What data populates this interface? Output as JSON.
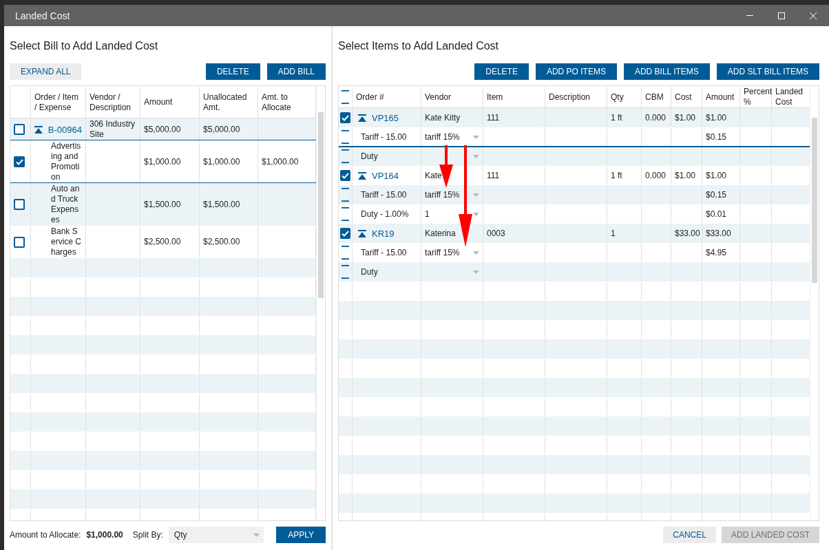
{
  "window": {
    "title": "Landed Cost"
  },
  "bill_panel": {
    "title": "Select Bill to Add Landed Cost",
    "buttons": [
      {
        "label": "EXPAND ALL",
        "kind": "secondary"
      },
      {
        "label": "DELETE",
        "kind": "primary"
      },
      {
        "label": "ADD BILL",
        "kind": "primary"
      }
    ],
    "columns": [
      "Order / Item / Expense",
      "Vendor / Description",
      "Amount",
      "Unallocated Amt.",
      "Amt. to Allocate"
    ],
    "rows": [
      {
        "kind": "bill",
        "checked": false,
        "selected": true,
        "order": "B-00964",
        "description": "306 Industry Site",
        "amount": "$5,000.00",
        "unallocated": "$5,000.00"
      },
      {
        "kind": "expense",
        "checked": true,
        "selected": true,
        "order": "Advertising and Promotion",
        "amount": "$1,000.00",
        "unallocated": "$1,000.00",
        "to_allocate": "$1,000.00"
      },
      {
        "kind": "expense",
        "checked": false,
        "selected": false,
        "order": "Auto and Truck Expenses",
        "amount": "$1,500.00",
        "unallocated": "$1,500.00"
      },
      {
        "kind": "expense",
        "checked": false,
        "selected": false,
        "order": "Bank Service Charges",
        "amount": "$2,500.00",
        "unallocated": "$2,500.00"
      }
    ],
    "footer": {
      "amount_label": "Amount to Allocate:",
      "amount_value": "$1,000.00",
      "split_label": "Split By:",
      "split_value": "Qty",
      "apply": "APPLY"
    }
  },
  "items_panel": {
    "title": "Select Items to Add Landed Cost",
    "buttons": [
      "DELETE",
      "ADD PO ITEMS",
      "ADD BILL ITEMS",
      "ADD SLT BILL ITEMS"
    ],
    "columns": [
      "Order #",
      "Vendor",
      "Item",
      "Description",
      "Qty",
      "CBM",
      "Cost",
      "Amount",
      "Percent %",
      "Landed Cost"
    ],
    "rows": [
      {
        "kind": "order",
        "checked": true,
        "order": "VP165",
        "vendor": "Kate Kitty",
        "item": "111",
        "qty": "1 ft",
        "cbm": "0.000",
        "cost": "$1.00",
        "amount": "$1.00"
      },
      {
        "kind": "charge",
        "selected": true,
        "label": "Tariff - 15.00",
        "vendor": "tariff 15%",
        "amount": "$0.15"
      },
      {
        "kind": "charge",
        "selected": false,
        "label": "Duty"
      },
      {
        "kind": "order",
        "checked": true,
        "order": "VP164",
        "vendor": "Kate",
        "item": "111",
        "qty": "1 ft",
        "cbm": "0.000",
        "cost": "$1.00",
        "amount": "$1.00"
      },
      {
        "kind": "charge",
        "selected": false,
        "label": "Tariff - 15.00",
        "vendor": "tariff 15%",
        "amount": "$0.15"
      },
      {
        "kind": "charge",
        "selected": false,
        "label": "Duty - 1.00%",
        "vendor": "1",
        "amount": "$0.01"
      },
      {
        "kind": "order",
        "checked": true,
        "order": "KR19",
        "vendor": "Katerina",
        "item": "0003",
        "qty": "1",
        "cost": "$33.00",
        "amount": "$33.00"
      },
      {
        "kind": "charge",
        "selected": false,
        "label": "Tariff - 15.00",
        "vendor": "tariff 15%",
        "amount": "$4.95"
      },
      {
        "kind": "charge",
        "selected": false,
        "label": "Duty"
      }
    ],
    "footer_buttons": [
      {
        "label": "CANCEL",
        "disabled": false
      },
      {
        "label": "ADD LANDED COST",
        "disabled": true
      }
    ]
  }
}
